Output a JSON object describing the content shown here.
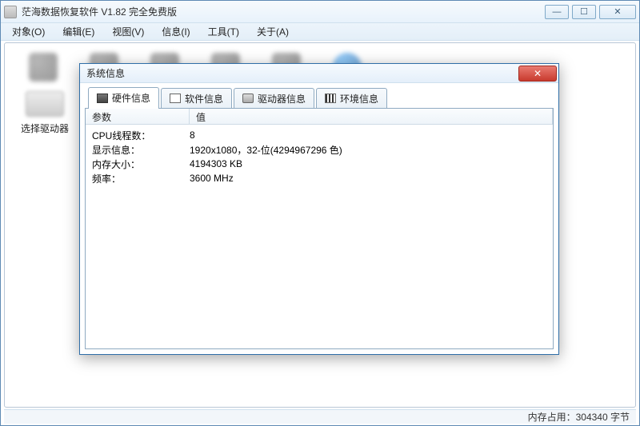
{
  "window": {
    "title": "茫海数据恢复软件 V1.82 完全免费版"
  },
  "menus": [
    {
      "label": "对象(O)"
    },
    {
      "label": "编辑(E)"
    },
    {
      "label": "视图(V)"
    },
    {
      "label": "信息(I)"
    },
    {
      "label": "工具(T)"
    },
    {
      "label": "关于(A)"
    }
  ],
  "sidebar": {
    "drive_label": "选择驱动器"
  },
  "statusbar": {
    "text": "内存占用：304340 字节"
  },
  "dialog": {
    "title": "系统信息",
    "close_glyph": "✕",
    "tabs": [
      {
        "label": "硬件信息"
      },
      {
        "label": "软件信息"
      },
      {
        "label": "驱动器信息"
      },
      {
        "label": "环境信息"
      }
    ],
    "columns": {
      "param": "参数",
      "value": "值"
    },
    "rows": [
      {
        "param": "CPU线程数：",
        "value": "8"
      },
      {
        "param": "显示信息：",
        "value": "1920x1080，32-位(4294967296 色)"
      },
      {
        "param": "内存大小：",
        "value": "4194303 KB"
      },
      {
        "param": "频率：",
        "value": "3600 MHz"
      }
    ]
  },
  "winbtns": {
    "min": "—",
    "max": "☐",
    "close": "✕"
  }
}
